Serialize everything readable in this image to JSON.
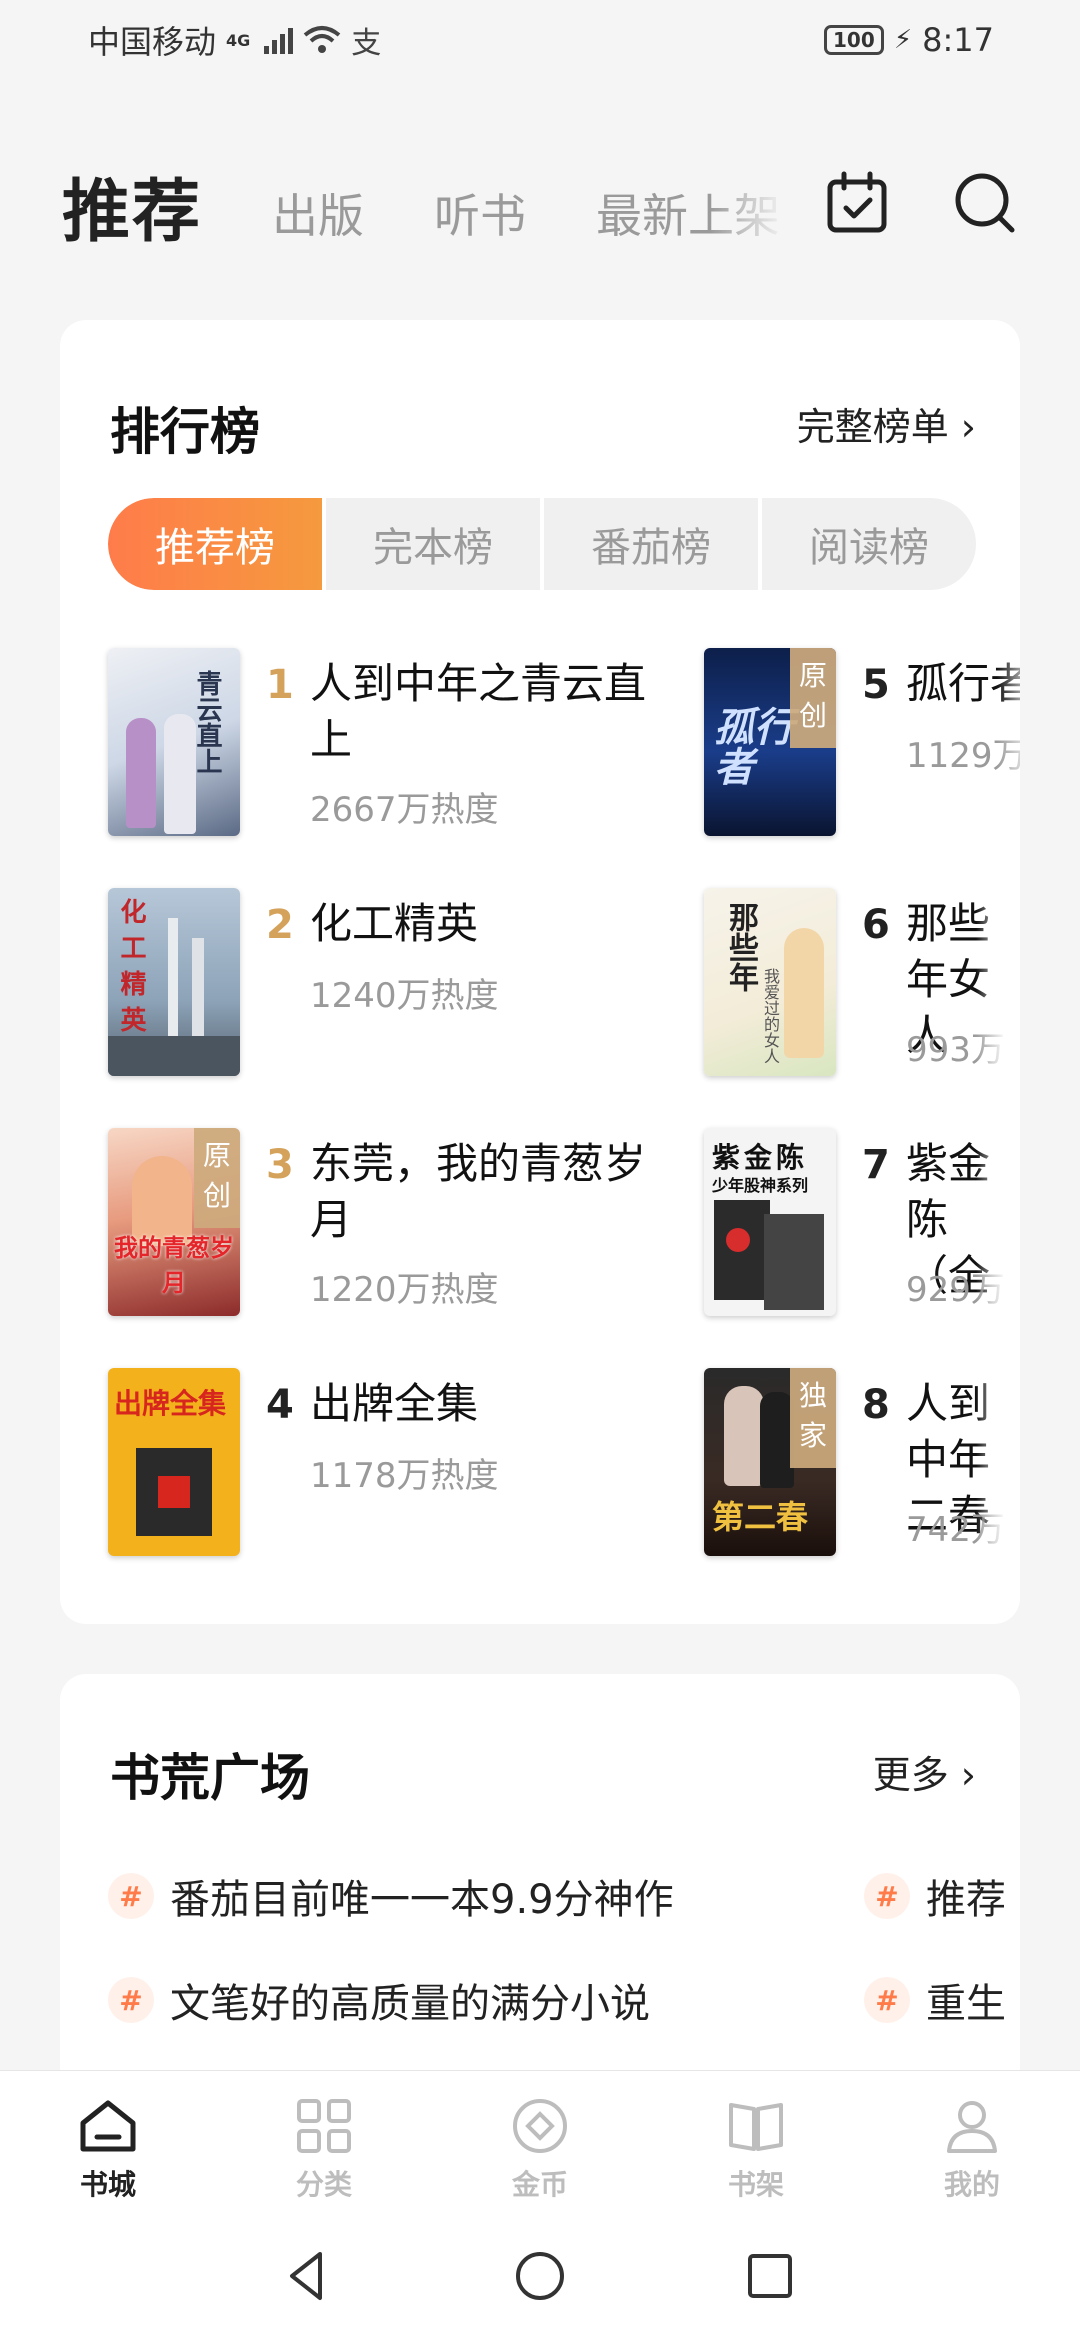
{
  "status_bar": {
    "carrier": "中国移动",
    "network": "4G",
    "battery": "100",
    "time": "8:17"
  },
  "header": {
    "tabs": [
      {
        "label": "推荐",
        "active": true
      },
      {
        "label": "出版"
      },
      {
        "label": "听书"
      },
      {
        "label": "最新上架"
      }
    ],
    "icons": [
      "calendar-check-icon",
      "search-icon"
    ]
  },
  "ranking": {
    "title": "排行榜",
    "more": "完整榜单 ›",
    "segments": [
      "推荐榜",
      "完本榜",
      "番茄榜",
      "阅读榜"
    ],
    "books": [
      {
        "rank": "1",
        "title": "人到中年之青云直上",
        "heat": "2667万热度",
        "badge": ""
      },
      {
        "rank": "2",
        "title": "化工精英",
        "heat": "1240万热度",
        "badge": ""
      },
      {
        "rank": "3",
        "title": "东莞，我的青葱岁月",
        "heat": "1220万热度",
        "badge": "原创"
      },
      {
        "rank": "4",
        "title": "出牌全集",
        "heat": "1178万热度",
        "badge": ""
      },
      {
        "rank": "5",
        "title": "孤行者",
        "heat": "1129万",
        "badge": "原创"
      },
      {
        "rank": "6",
        "title": "那些年女人",
        "heat": "993万",
        "badge": ""
      },
      {
        "rank": "7",
        "title": "紫金陈（全",
        "heat": "929万",
        "badge": ""
      },
      {
        "rank": "8",
        "title": "人到中年二春",
        "heat": "742万",
        "badge": "独家"
      }
    ],
    "cover_texts": {
      "c1": "青云直上",
      "c2": "化工精英",
      "c3": "我的青葱岁月",
      "c4": "出牌全集",
      "c5": "孤行者",
      "c6": "那些年",
      "c6b": "我爱过的女人",
      "c7": "紫金陈",
      "c7b": "少年股神系列",
      "c8": "第二春"
    }
  },
  "square": {
    "title": "书荒广场",
    "more": "更多 ›",
    "topics": [
      "番茄目前唯一一本9.9分神作",
      "推荐",
      "文笔好的高质量的满分小说",
      "重生"
    ]
  },
  "bottom_nav": [
    {
      "label": "书城",
      "icon": "home-icon",
      "active": true
    },
    {
      "label": "分类",
      "icon": "grid-icon"
    },
    {
      "label": "金币",
      "icon": "coin-icon"
    },
    {
      "label": "书架",
      "icon": "bookshelf-icon"
    },
    {
      "label": "我的",
      "icon": "profile-icon"
    }
  ],
  "colors": {
    "accent": "#ff7c4a",
    "rank_gold": "#d4a25a"
  }
}
